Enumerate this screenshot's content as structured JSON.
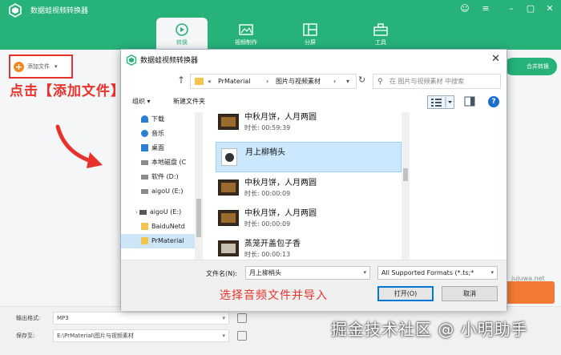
{
  "app": {
    "title": "数据蛙视频转换器",
    "nav": [
      {
        "label": "转换",
        "active": true
      },
      {
        "label": "视频制作",
        "active": false
      },
      {
        "label": "分屏",
        "active": false
      },
      {
        "label": "工具",
        "active": false
      }
    ],
    "add_file_label": "添加文件",
    "side_button_label": "合并转换",
    "side_url": "jujuwa.net",
    "bottom": {
      "output_format_label": "输出格式:",
      "output_format_value": "MP3",
      "save_to_label": "保存至:",
      "save_to_value": "E:\\PrMaterial\\图片与视频素材"
    },
    "accent_color": "#27b27a"
  },
  "annotations": {
    "left": "点击【添加文件】按钮",
    "bottom": "选择音频文件并导入",
    "watermark": "掘金技术社区 @ 小明助手"
  },
  "dialog": {
    "title": "数据蛙视频转换器",
    "breadcrumb": [
      "«",
      "PrMaterial",
      "›",
      "图片与视频素材",
      "›"
    ],
    "search_placeholder": "在 图片与视频素材 中搜索",
    "toolbar": {
      "organize": "组织 ▾",
      "new_folder": "新建文件夹"
    },
    "tree": [
      {
        "label": "下载",
        "icon": "download-icon"
      },
      {
        "label": "音乐",
        "icon": "music-icon"
      },
      {
        "label": "桌面",
        "icon": "desktop-icon"
      },
      {
        "label": "本地磁盘 (C",
        "icon": "drive-icon"
      },
      {
        "label": "软件 (D:)",
        "icon": "drive-icon"
      },
      {
        "label": "aigoU (E:)",
        "icon": "drive-icon"
      },
      {
        "label": "aigoU (E:)",
        "icon": "usb-icon"
      },
      {
        "label": "BaiduNetd",
        "icon": "folder-icon"
      },
      {
        "label": "PrMaterial",
        "icon": "folder-icon",
        "selected": true
      }
    ],
    "files": [
      {
        "name": "中秋月饼，人月两圆",
        "duration": "时长: 00:59:39",
        "type": "video"
      },
      {
        "name": "月上柳梢头",
        "duration": "",
        "type": "audio",
        "selected": true
      },
      {
        "name": "中秋月饼，人月两圆",
        "duration": "时长: 00:00:09",
        "type": "video"
      },
      {
        "name": "中秋月饼，人月两圆",
        "duration": "时长: 00:00:09",
        "type": "video"
      },
      {
        "name": "蒸笼开盖包子香",
        "duration": "时长: 00:00:13",
        "type": "video"
      }
    ],
    "filename_label": "文件名(N):",
    "filename_value": "月上柳梢头",
    "format_value": "All Supported Formats (*.ts;*",
    "open_label": "打开(O)",
    "cancel_label": "取消"
  }
}
